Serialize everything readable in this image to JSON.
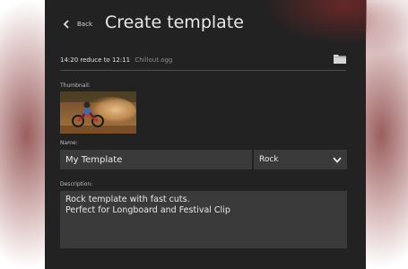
{
  "header": {
    "back_label": "Back",
    "title": "Create template"
  },
  "music": {
    "duration_text": "14:20 reduce to 12:11",
    "file_name": "Chillout.ogg",
    "folder_icon": "folder-icon"
  },
  "thumbnail": {
    "label": "Thumbnail:",
    "image": "motocross-rider-photo"
  },
  "name": {
    "label": "Name:",
    "value": "My Template"
  },
  "genre": {
    "value": "Rock",
    "icon": "chevron-down-icon"
  },
  "description": {
    "label": "Description:",
    "value": "Rock template with fast cuts.\nPerfect for Longboard and Festival Clip"
  },
  "colors": {
    "panel_bg": "#222222",
    "field_bg": "#3a3a3a",
    "splatter": "#8a3a3a"
  }
}
